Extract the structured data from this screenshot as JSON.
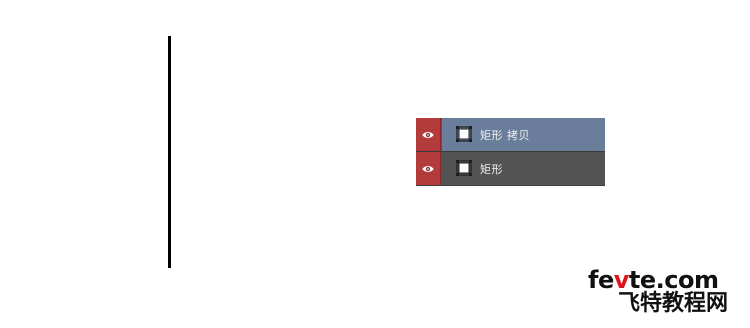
{
  "layers": [
    {
      "name": "矩形 拷贝",
      "visible": true,
      "selected": true,
      "kind": "shape-layer-icon"
    },
    {
      "name": "矩形",
      "visible": true,
      "selected": false,
      "kind": "shape-layer-icon"
    }
  ],
  "watermark": {
    "url_prefix": "fe",
    "url_accent": "v",
    "url_suffix": "te.com",
    "cn_text": "飞特教程网"
  },
  "colors": {
    "eye_cell": "#b33b3b",
    "selected_row": "#6a7d9a",
    "panel_bg": "#535353",
    "divider_line": "#000000",
    "watermark_accent": "#e0121b"
  }
}
